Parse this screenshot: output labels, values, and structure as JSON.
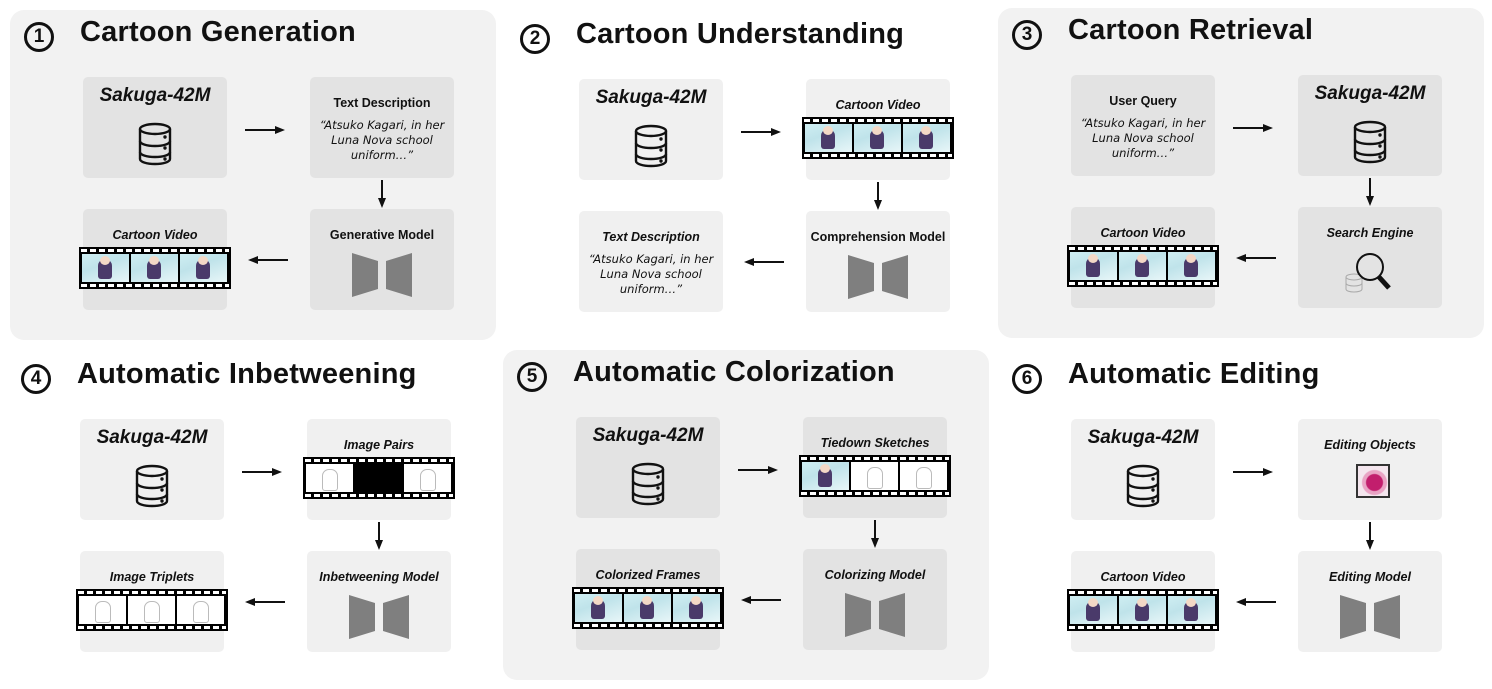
{
  "db_label": "Sakuga-42M",
  "quote": "“Atsuko Kagari, in her Luna Nova school uniform…”",
  "colors": {
    "panel_bg": "#f2f2f2",
    "box_bg": "#e3e3e3",
    "model": "#7f7f7f",
    "film": "#000000"
  },
  "panels": [
    {
      "number": "1",
      "title": "Cartoon Generation",
      "highlighted": true,
      "boxes": {
        "tl": {
          "type": "db"
        },
        "tr": {
          "type": "text",
          "label": "Text Description"
        },
        "br": {
          "type": "model",
          "label": "Generative Model"
        },
        "bl": {
          "type": "video",
          "label": "Cartoon Video",
          "frames": [
            "color",
            "color",
            "color"
          ]
        }
      }
    },
    {
      "number": "2",
      "title": "Cartoon Understanding",
      "highlighted": false,
      "boxes": {
        "tl": {
          "type": "db"
        },
        "tr": {
          "type": "video",
          "label": "Cartoon Video",
          "frames": [
            "color",
            "color",
            "color"
          ]
        },
        "br": {
          "type": "model",
          "label": "Comprehension Model"
        },
        "bl": {
          "type": "text",
          "label": "Text Description"
        }
      }
    },
    {
      "number": "3",
      "title": "Cartoon Retrieval",
      "highlighted": true,
      "boxes": {
        "tl": {
          "type": "text",
          "label": "User Query"
        },
        "tr": {
          "type": "db"
        },
        "br": {
          "type": "search",
          "label": "Search Engine"
        },
        "bl": {
          "type": "video",
          "label": "Cartoon Video",
          "frames": [
            "color",
            "color",
            "color"
          ]
        }
      }
    },
    {
      "number": "4",
      "title": "Automatic Inbetweening",
      "highlighted": false,
      "boxes": {
        "tl": {
          "type": "db"
        },
        "tr": {
          "type": "video",
          "label": "Image Pairs",
          "frames": [
            "sketch",
            "black",
            "sketch"
          ]
        },
        "br": {
          "type": "model",
          "label": "Inbetweening Model"
        },
        "bl": {
          "type": "video",
          "label": "Image Triplets",
          "frames": [
            "sketch",
            "sketch",
            "sketch"
          ]
        }
      }
    },
    {
      "number": "5",
      "title": "Automatic Colorization",
      "highlighted": true,
      "boxes": {
        "tl": {
          "type": "db"
        },
        "tr": {
          "type": "video",
          "label": "Tiedown Sketches",
          "frames": [
            "color",
            "sketch",
            "sketch"
          ]
        },
        "br": {
          "type": "model",
          "label": "Colorizing Model"
        },
        "bl": {
          "type": "video",
          "label": "Colorized Frames",
          "frames": [
            "color",
            "color",
            "color"
          ]
        }
      }
    },
    {
      "number": "6",
      "title": "Automatic Editing",
      "highlighted": false,
      "boxes": {
        "tl": {
          "type": "db"
        },
        "tr": {
          "type": "edit",
          "label": "Editing Objects"
        },
        "br": {
          "type": "model",
          "label": "Editing Model"
        },
        "bl": {
          "type": "video",
          "label": "Cartoon Video",
          "frames": [
            "color",
            "color",
            "color"
          ]
        }
      }
    }
  ]
}
